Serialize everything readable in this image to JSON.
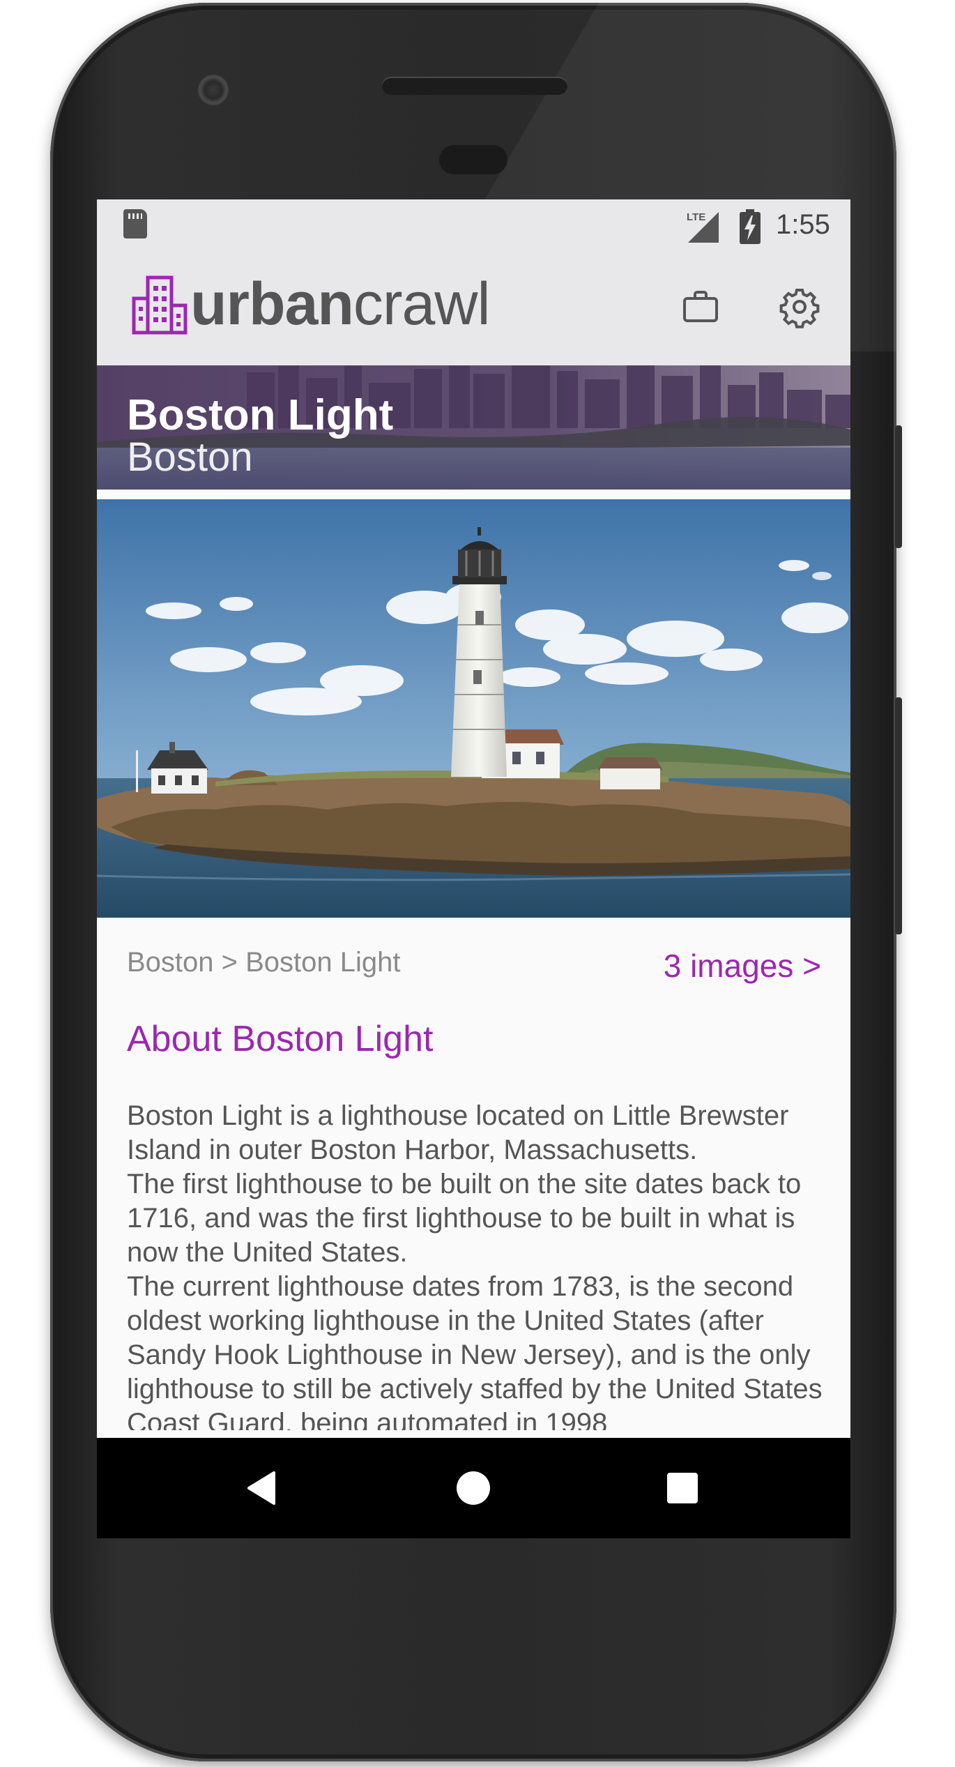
{
  "status_bar": {
    "time": "1:55",
    "network": "LTE"
  },
  "app_bar": {
    "brand_bold": "urban",
    "brand_light": "crawl",
    "briefcase_icon": "briefcase-icon",
    "settings_icon": "gear-icon"
  },
  "header": {
    "title": "Boston Light",
    "subtitle": "Boston"
  },
  "detail": {
    "breadcrumb": "Boston > Boston Light",
    "images_link": "3 images >",
    "about_title": "About Boston Light",
    "paragraphs": [
      "Boston Light is a lighthouse located on Little Brewster Island in outer Boston Harbor, Massachusetts.",
      "The first lighthouse to be built on the site dates back to 1716, and was the first lighthouse to be built in what is now the United States.",
      "The current lighthouse dates from 1783, is the second oldest working lighthouse in the United States (after Sandy Hook Lighthouse in New Jersey), and is the only lighthouse to still be actively staffed by the United States Coast Guard, being automated in 1998"
    ]
  },
  "nav_bar": {
    "back": "back-icon",
    "home": "home-icon",
    "recents": "recents-icon"
  },
  "colors": {
    "accent": "#9c27b0",
    "toolbar": "#e8e8ea",
    "text": "#555555"
  }
}
